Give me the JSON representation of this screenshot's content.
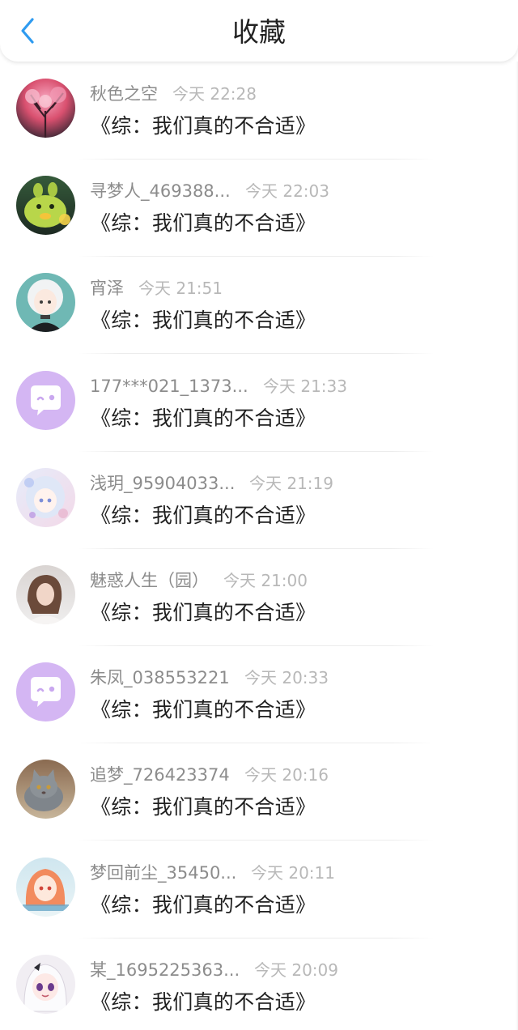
{
  "header": {
    "title": "收藏",
    "back_icon": "chevron-left-icon",
    "accent_color": "#2f9bf0"
  },
  "items": [
    {
      "username": "秋色之空",
      "time": "今天 22:28",
      "book": "《综：我们真的不合适》",
      "avatar": "pink-blossom-tree"
    },
    {
      "username": "寻梦人_469388...",
      "time": "今天 22:03",
      "book": "《综：我们真的不合适》",
      "avatar": "green-cartoon-creature"
    },
    {
      "username": "宵泽",
      "time": "今天 21:51",
      "book": "《综：我们真的不合适》",
      "avatar": "anime-boy-white-hair"
    },
    {
      "username": "177***021_1373...",
      "time": "今天 21:33",
      "book": "《综：我们真的不合适》",
      "avatar": "default-chat-bubble-icon"
    },
    {
      "username": "浅玥_95904033...",
      "time": "今天 21:19",
      "book": "《综：我们真的不合适》",
      "avatar": "anime-girl-pastel"
    },
    {
      "username": "魅惑人生（园）",
      "time": "今天 21:00",
      "book": "《综：我们真的不合适》",
      "avatar": "portrait-woman-photo"
    },
    {
      "username": "朱凤_038553221",
      "time": "今天 20:33",
      "book": "《综：我们真的不合适》",
      "avatar": "default-chat-bubble-icon"
    },
    {
      "username": "追梦_726423374",
      "time": "今天 20:16",
      "book": "《综：我们真的不合适》",
      "avatar": "grey-cat-photo"
    },
    {
      "username": "梦回前尘_35450...",
      "time": "今天 20:11",
      "book": "《综：我们真的不合适》",
      "avatar": "anime-girl-orange-hair"
    },
    {
      "username": "某_1695225363...",
      "time": "今天 20:09",
      "book": "《综：我们真的不合适》",
      "avatar": "anime-girl-purple-eyes"
    }
  ]
}
